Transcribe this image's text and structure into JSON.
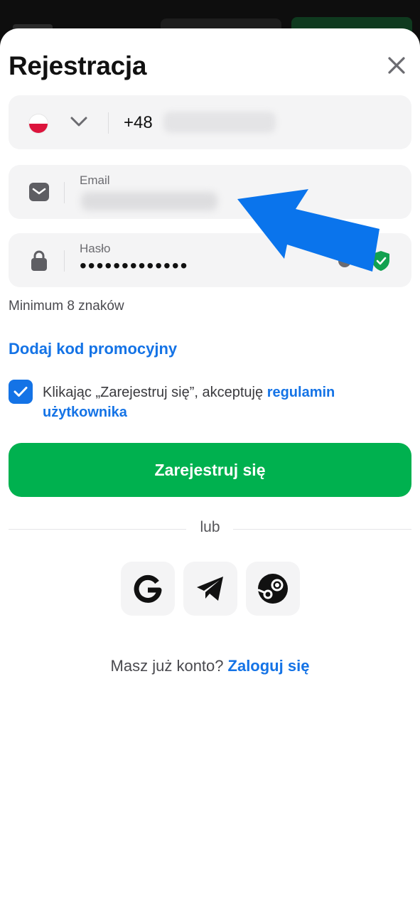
{
  "title": "Rejestracja",
  "phone": {
    "prefix": "+48",
    "country_flag": "poland-flag"
  },
  "email": {
    "label": "Email"
  },
  "password": {
    "label": "Hasło",
    "masked_value": "•••••••••••••"
  },
  "hint": "Minimum 8 znaków",
  "promo_link": "Dodaj kod promocyjny",
  "terms": {
    "checked": true,
    "text": "Klikając „Zarejestruj się”, akceptuję ",
    "link": "regulamin użytkownika"
  },
  "register_button": "Zarejestruj się",
  "divider_text": "lub",
  "social": [
    {
      "name": "google",
      "icon": "google-icon"
    },
    {
      "name": "telegram",
      "icon": "telegram-icon"
    },
    {
      "name": "steam",
      "icon": "steam-icon"
    }
  ],
  "footer": {
    "question": "Masz już konto?",
    "login_link": "Zaloguj się"
  },
  "colors": {
    "primary": "#00b14f",
    "link": "#1473e6",
    "field_bg": "#f4f4f5",
    "shield": "#12a150",
    "annotation_arrow": "#0a74ec"
  }
}
